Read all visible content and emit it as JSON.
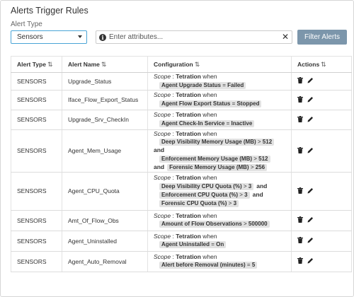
{
  "page": {
    "title": "Alerts Trigger Rules"
  },
  "filter": {
    "alert_type_label": "Alert Type",
    "selected": "Sensors",
    "search_placeholder": "Enter attributes...",
    "filter_button": "Filter Alerts"
  },
  "table": {
    "headers": [
      "Alert Type",
      "Alert Name",
      "Configuration",
      "Actions"
    ],
    "scope_label": "Scope",
    "scope_sep": " : ",
    "scope_value": "Tetration",
    "when": " when",
    "and": "and",
    "rows": [
      {
        "type": "SENSORS",
        "name": "Upgrade_Status",
        "conditions": [
          {
            "field": "Agent Upgrade Status",
            "op": " = ",
            "value": "Failed"
          }
        ]
      },
      {
        "type": "SENSORS",
        "name": "Iface_Flow_Export_Status",
        "conditions": [
          {
            "field": "Agent Flow Export Status",
            "op": " = ",
            "value": "Stopped"
          }
        ]
      },
      {
        "type": "SENSORS",
        "name": "Upgrade_Srv_CheckIn",
        "conditions": [
          {
            "field": "Agent Check-In Service",
            "op": " = ",
            "value": "Inactive"
          }
        ]
      },
      {
        "type": "SENSORS",
        "name": "Agent_Mem_Usage",
        "conditions": [
          {
            "field": "Deep Visibility Memory Usage (MB)",
            "op": " > ",
            "value": "512"
          },
          {
            "field": "Enforcement Memory Usage (MB)",
            "op": " > ",
            "value": "512"
          },
          {
            "field": "Forensic Memory Usage (MB)",
            "op": " > ",
            "value": "256"
          }
        ]
      },
      {
        "type": "SENSORS",
        "name": "Agent_CPU_Quota",
        "conditions": [
          {
            "field": "Deep Visibility CPU Quota (%)",
            "op": " > ",
            "value": "3"
          },
          {
            "field": "Enforcement CPU Quota (%)",
            "op": " > ",
            "value": "3"
          },
          {
            "field": "Forensic CPU Quota (%)",
            "op": " > ",
            "value": "3"
          }
        ]
      },
      {
        "type": "SENSORS",
        "name": "Amt_Of_Flow_Obs",
        "conditions": [
          {
            "field": "Amount of Flow Observations",
            "op": " > ",
            "value": "500000"
          }
        ]
      },
      {
        "type": "SENSORS",
        "name": "Agent_Uninstalled",
        "conditions": [
          {
            "field": "Agent Uninstalled",
            "op": " = ",
            "value": "On"
          }
        ]
      },
      {
        "type": "SENSORS",
        "name": "Agent_Auto_Removal",
        "conditions": [
          {
            "field": "Alert before Removal (minutes)",
            "op": " = ",
            "value": "5"
          }
        ]
      }
    ]
  },
  "icons": {
    "delete": "trash-icon",
    "edit": "pencil-icon",
    "sort": "sort-arrows-icon",
    "info": "info-icon",
    "clear": "close-icon",
    "dropdown": "chevron-down-icon"
  }
}
